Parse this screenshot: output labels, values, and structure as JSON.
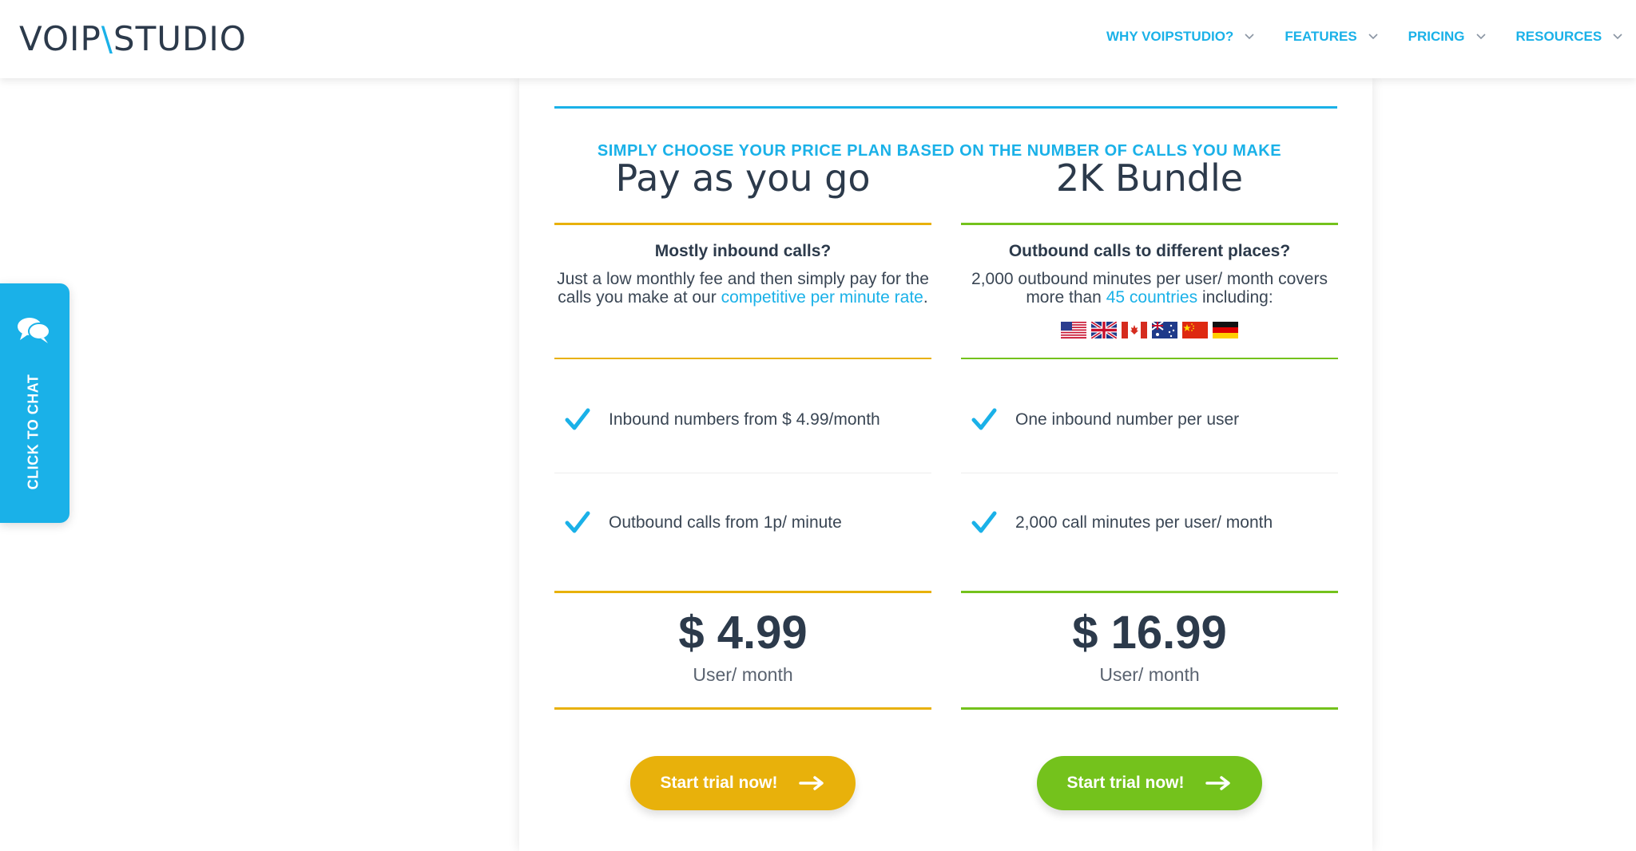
{
  "header": {
    "logo_left": "VOIP",
    "logo_slash": "\\",
    "logo_right": "STUDIO",
    "nav": [
      {
        "label": "WHY VOIPSTUDIO?"
      },
      {
        "label": "FEATURES"
      },
      {
        "label": "PRICING"
      },
      {
        "label": "RESOURCES"
      }
    ]
  },
  "tagline": "Simply choose your price plan based on the number of calls you make",
  "plans": [
    {
      "title": "Pay as you go",
      "subtitle": "Mostly inbound calls?",
      "desc_text": "Just a low monthly fee and then simply pay for the calls you make at our ",
      "desc_link": "competitive per minute rate",
      "desc_end": ".",
      "features": [
        "Inbound numbers from $ 4.99/month",
        "Outbound calls from 1p/ minute"
      ],
      "price": "$ 4.99",
      "per": "User/ month",
      "button": "Start trial now!",
      "accent": "#e8b10b"
    },
    {
      "title": "2K Bundle",
      "subtitle": "Outbound calls to different places?",
      "desc_text": "2,000 outbound minutes per user/ month covers more than ",
      "desc_link": "45 countries",
      "desc_end": " including:",
      "flags": [
        "us-flag",
        "uk-flag",
        "canada-flag",
        "australia-flag",
        "china-flag",
        "germany-flag"
      ],
      "features": [
        "One inbound number per user",
        "2,000 call minutes per user/ month"
      ],
      "price": "$ 16.99",
      "per": "User/ month",
      "button": "Start trial now!",
      "accent": "#74c21c"
    }
  ],
  "chat": {
    "label": "CLICK TO CHAT"
  },
  "colors": {
    "brand": "#1ab1e8",
    "text": "#2c3a4b"
  }
}
